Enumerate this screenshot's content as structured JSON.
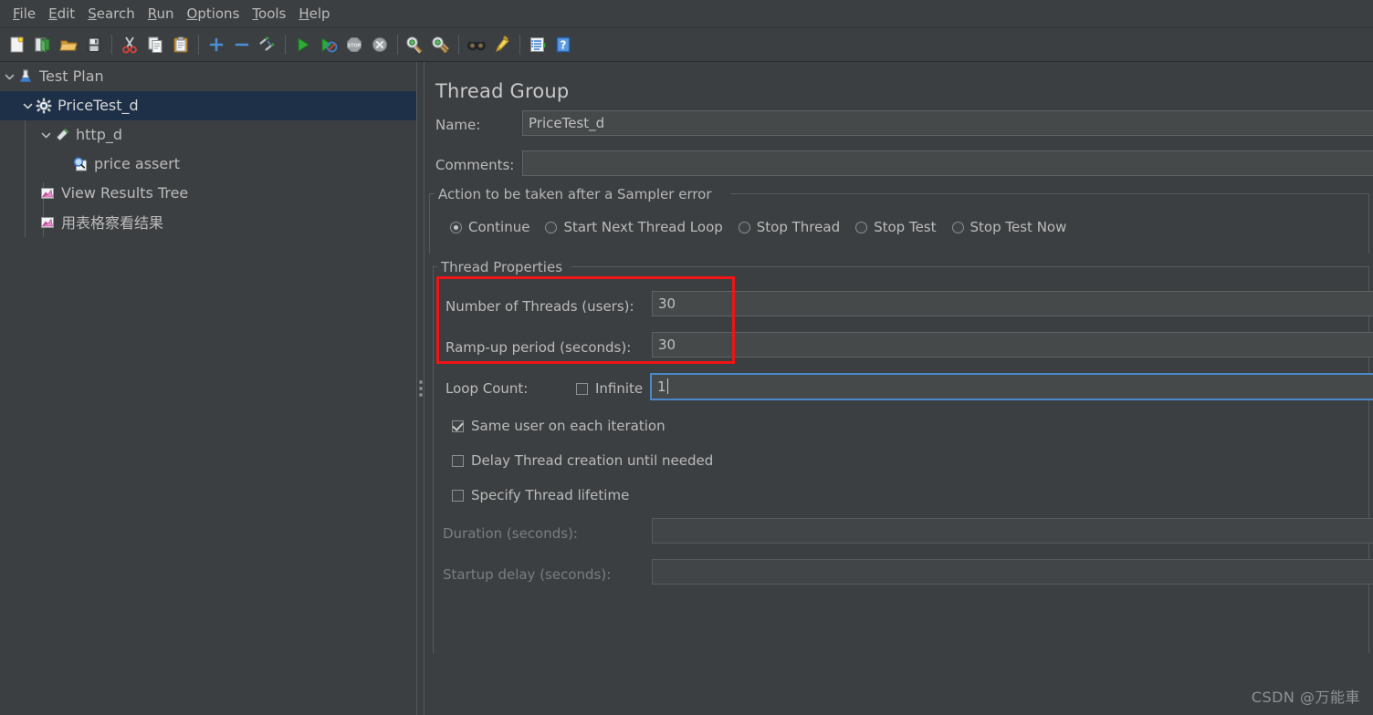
{
  "menubar": {
    "items": [
      {
        "name": "file",
        "pre": "",
        "mnemonic": "F",
        "post": "ile"
      },
      {
        "name": "edit",
        "pre": "",
        "mnemonic": "E",
        "post": "dit"
      },
      {
        "name": "search",
        "pre": "",
        "mnemonic": "S",
        "post": "earch"
      },
      {
        "name": "run",
        "pre": "",
        "mnemonic": "R",
        "post": "un"
      },
      {
        "name": "options",
        "pre": "",
        "mnemonic": "O",
        "post": "ptions"
      },
      {
        "name": "tools",
        "pre": "",
        "mnemonic": "T",
        "post": "ools"
      },
      {
        "name": "help",
        "pre": "",
        "mnemonic": "H",
        "post": "elp"
      }
    ]
  },
  "toolbar": {
    "buttons": [
      {
        "name": "new-icon",
        "title": "New"
      },
      {
        "name": "templates-icon",
        "title": "Templates"
      },
      {
        "name": "open-icon",
        "title": "Open"
      },
      {
        "name": "save-icon",
        "title": "Save"
      },
      {
        "sep": true
      },
      {
        "name": "cut-icon",
        "title": "Cut"
      },
      {
        "name": "copy-icon",
        "title": "Copy"
      },
      {
        "name": "paste-icon",
        "title": "Paste"
      },
      {
        "sep": true
      },
      {
        "name": "expand-all-icon",
        "title": "Expand All"
      },
      {
        "name": "collapse-all-icon",
        "title": "Collapse All"
      },
      {
        "name": "toggle-icon",
        "title": "Toggle"
      },
      {
        "sep": true
      },
      {
        "name": "start-icon",
        "title": "Start"
      },
      {
        "name": "start-no-pauses-icon",
        "title": "Start no pauses"
      },
      {
        "name": "stop-icon",
        "title": "Stop"
      },
      {
        "name": "shutdown-icon",
        "title": "Shutdown"
      },
      {
        "sep": true
      },
      {
        "name": "clear-icon",
        "title": "Clear"
      },
      {
        "name": "clear-all-icon",
        "title": "Clear All"
      },
      {
        "sep": true
      },
      {
        "name": "search-icon",
        "title": "Search"
      },
      {
        "name": "search-reset-icon",
        "title": "Reset Search"
      },
      {
        "sep": true
      },
      {
        "name": "function-helper-icon",
        "title": "Function Helper Dialog"
      },
      {
        "name": "help-icon",
        "title": "Help"
      }
    ]
  },
  "tree": {
    "items": [
      {
        "name": "test-plan",
        "label": "Test Plan",
        "icon": "test-plan-icon",
        "depth": 0,
        "twisty": "down",
        "selected": false
      },
      {
        "name": "thread-group-pricetest-d",
        "label": "PriceTest_d",
        "icon": "thread-group-icon",
        "depth": 1,
        "twisty": "down",
        "selected": true
      },
      {
        "name": "http-sampler-http-d",
        "label": "http_d",
        "icon": "http-sampler-icon",
        "depth": 2,
        "twisty": "down",
        "selected": false
      },
      {
        "name": "assertion-price-assert",
        "label": "price assert",
        "icon": "assertion-icon",
        "depth": 3,
        "twisty": "none",
        "selected": false
      },
      {
        "name": "listener-view-results-tree",
        "label": "View Results Tree",
        "icon": "listener-icon",
        "depth": 2,
        "twisty": "none",
        "selected": false
      },
      {
        "name": "listener-table-results",
        "label": "用表格察看结果",
        "icon": "listener-icon",
        "depth": 2,
        "twisty": "none",
        "selected": false
      }
    ]
  },
  "panel": {
    "title": "Thread Group",
    "name_label": "Name:",
    "name_value": "PriceTest_d",
    "comments_label": "Comments:",
    "comments_value": "",
    "sampler_error": {
      "group_title": "Action to be taken after a Sampler error",
      "options": [
        {
          "name": "continue",
          "label": "Continue",
          "selected": true
        },
        {
          "name": "start-next-thread-loop",
          "label": "Start Next Thread Loop",
          "selected": false
        },
        {
          "name": "stop-thread",
          "label": "Stop Thread",
          "selected": false
        },
        {
          "name": "stop-test",
          "label": "Stop Test",
          "selected": false
        },
        {
          "name": "stop-test-now",
          "label": "Stop Test Now",
          "selected": false
        }
      ]
    },
    "thread_properties": {
      "group_title": "Thread Properties",
      "num_threads_label": "Number of Threads (users):",
      "num_threads_value": "30",
      "ramp_up_label": "Ramp-up period (seconds):",
      "ramp_up_value": "30",
      "loop_count_label": "Loop Count:",
      "infinite_label": "Infinite",
      "infinite_checked": false,
      "loop_count_value": "1",
      "same_user_label": "Same user on each iteration",
      "same_user_checked": true,
      "delay_thread_label": "Delay Thread creation until needed",
      "delay_thread_checked": false,
      "specify_lifetime_label": "Specify Thread lifetime",
      "specify_lifetime_checked": false,
      "duration_label": "Duration (seconds):",
      "duration_value": "",
      "startup_delay_label": "Startup delay (seconds):",
      "startup_delay_value": ""
    }
  },
  "annotation": {
    "name": "red-highlight-box",
    "color": "#f01414"
  },
  "watermark": {
    "text": "CSDN @万能車"
  },
  "colors": {
    "background": "#3c3f41",
    "selection": "#1d3048",
    "text": "#bbbbbb",
    "field_bg": "#45494a",
    "focus_border": "#4a88c7",
    "accent_red": "#f01414"
  }
}
